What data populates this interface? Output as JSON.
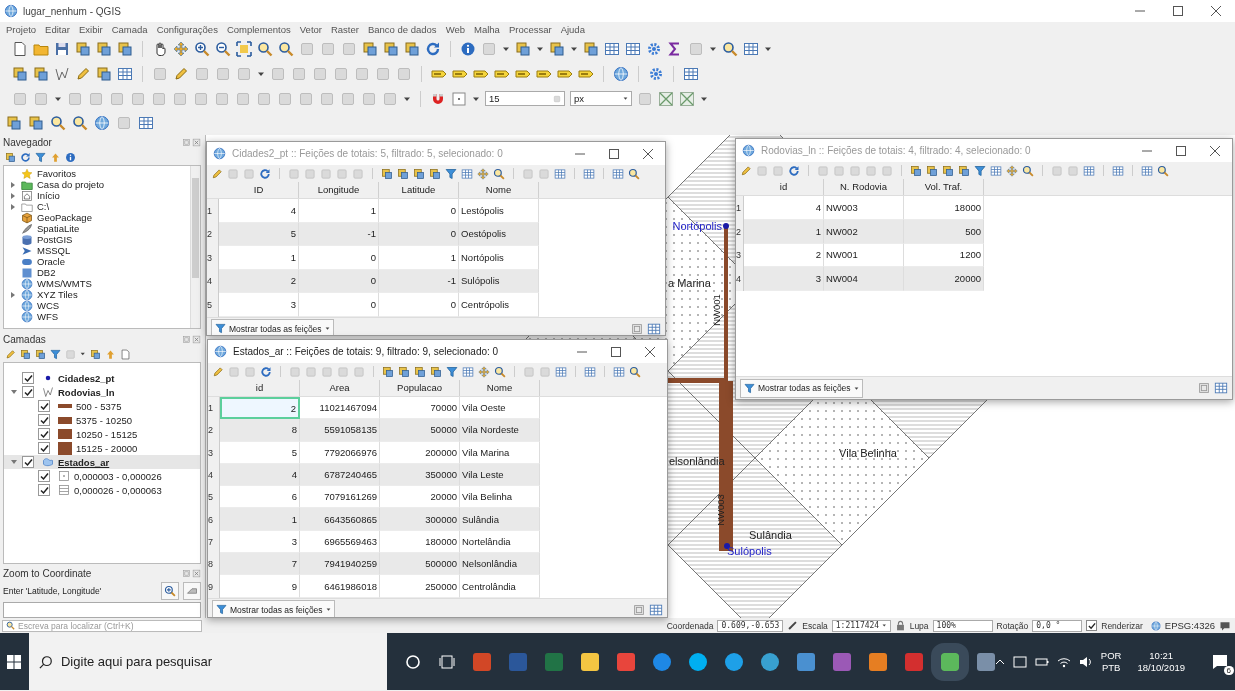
{
  "window": {
    "title": "lugar_nenhum - QGIS"
  },
  "menu": [
    "Projeto",
    "Editar",
    "Exibir",
    "Camada",
    "Configurações",
    "Complementos",
    "Vetor",
    "Raster",
    "Banco de dados",
    "Web",
    "Malha",
    "Processar",
    "Ajuda"
  ],
  "snapping": {
    "tolerance": "15",
    "unit": "px"
  },
  "navigator": {
    "title": "Navegador",
    "items": [
      {
        "label": "Favoritos",
        "kind": "favorites",
        "expandable": false
      },
      {
        "label": "Casa do projeto",
        "kind": "project",
        "expandable": true
      },
      {
        "label": "Início",
        "kind": "home",
        "expandable": true
      },
      {
        "label": "C:\\",
        "kind": "folder",
        "expandable": true
      },
      {
        "label": "GeoPackage",
        "kind": "geopackage",
        "expandable": false
      },
      {
        "label": "SpatiaLite",
        "kind": "spatialite",
        "expandable": false
      },
      {
        "label": "PostGIS",
        "kind": "database",
        "expandable": false
      },
      {
        "label": "MSSQL",
        "kind": "mssql",
        "expandable": false
      },
      {
        "label": "Oracle",
        "kind": "oracle",
        "expandable": false
      },
      {
        "label": "DB2",
        "kind": "db2",
        "expandable": false
      },
      {
        "label": "WMS/WMTS",
        "kind": "service",
        "expandable": false
      },
      {
        "label": "XYZ Tiles",
        "kind": "service",
        "expandable": true
      },
      {
        "label": "WCS",
        "kind": "service",
        "expandable": false
      },
      {
        "label": "WFS",
        "kind": "service",
        "expandable": false
      }
    ]
  },
  "layers": {
    "title": "Camadas",
    "items": [
      {
        "name": "Cidades2_pt",
        "kind": "point",
        "checked": true,
        "selected": false
      },
      {
        "name": "Rodovias_ln",
        "kind": "line",
        "checked": true,
        "selected": false,
        "expanded": true,
        "children": [
          {
            "label": "500 - 5375",
            "kind": "road-class",
            "checked": true
          },
          {
            "label": "5375 - 10250",
            "kind": "road-class",
            "checked": true
          },
          {
            "label": "10250 - 15125",
            "kind": "road-class",
            "checked": true
          },
          {
            "label": "15125 - 20000",
            "kind": "road-class",
            "checked": true
          }
        ]
      },
      {
        "name": "Estados_ar",
        "kind": "polygon",
        "checked": true,
        "selected": true,
        "expanded": true,
        "children": [
          {
            "label": "0,000003 - 0,000026",
            "kind": "dots",
            "checked": true
          },
          {
            "label": "0,000026 - 0,000063",
            "kind": "hatch",
            "checked": true
          }
        ]
      }
    ]
  },
  "zoom_to_coordinate": {
    "title": "Zoom to Coordinate",
    "label": "Enter 'Latitude, Longitude'"
  },
  "locator": {
    "placeholder": "Escreva para localizar (Ctrl+K)"
  },
  "map": {
    "labels": [
      {
        "text": "Nortópolis",
        "kind": "city"
      },
      {
        "text": "a Marina",
        "kind": "state"
      },
      {
        "text": "NW001",
        "kind": "road"
      },
      {
        "text": "elsonlândia",
        "kind": "state"
      },
      {
        "text": "Vila Belinha",
        "kind": "state"
      },
      {
        "text": "NW003",
        "kind": "road"
      },
      {
        "text": "Sulândia",
        "kind": "state"
      },
      {
        "text": "Sulópolis",
        "kind": "city"
      }
    ]
  },
  "attribute_tables": [
    {
      "title": "Cidades2_pt :: Feições de totais: 5, filtrado: 5, selecionado: 0",
      "active": false,
      "columns": [
        {
          "label": "ID",
          "kind": "number"
        },
        {
          "label": "Longitude",
          "kind": "number"
        },
        {
          "label": "Latitude",
          "kind": "number"
        },
        {
          "label": "Nome",
          "kind": "text"
        }
      ],
      "rows": [
        {
          "number": "1",
          "cells": [
            "4",
            "1",
            "0",
            "Lestópolis"
          ],
          "current": false
        },
        {
          "number": "2",
          "cells": [
            "5",
            "-1",
            "0",
            "Oestópolis"
          ],
          "current": false
        },
        {
          "number": "3",
          "cells": [
            "1",
            "0",
            "1",
            "Nortópolis"
          ],
          "current": false
        },
        {
          "number": "4",
          "cells": [
            "2",
            "0",
            "-1",
            "Sulópolis"
          ],
          "current": false
        },
        {
          "number": "5",
          "cells": [
            "3",
            "0",
            "0",
            "Centrópolis"
          ],
          "current": false
        }
      ],
      "filter_button": "Mostrar todas as feições"
    },
    {
      "title": "Estados_ar :: Feições de totais: 9, filtrado: 9, selecionado: 0",
      "active": true,
      "columns": [
        {
          "label": "id",
          "kind": "number"
        },
        {
          "label": "Area",
          "kind": "number"
        },
        {
          "label": "Populacao",
          "kind": "number"
        },
        {
          "label": "Nome",
          "kind": "text"
        }
      ],
      "rows": [
        {
          "number": "1",
          "cells": [
            "2",
            "11021467094",
            "70000",
            "Vila Oeste"
          ],
          "current": true
        },
        {
          "number": "2",
          "cells": [
            "8",
            "5591058135",
            "50000",
            "Vila Nordeste"
          ],
          "current": false
        },
        {
          "number": "3",
          "cells": [
            "5",
            "7792066976",
            "200000",
            "Vila Marina"
          ],
          "current": false
        },
        {
          "number": "4",
          "cells": [
            "4",
            "6787240465",
            "350000",
            "Vila Leste"
          ],
          "current": false
        },
        {
          "number": "5",
          "cells": [
            "6",
            "7079161269",
            "20000",
            "Vila Belinha"
          ],
          "current": false
        },
        {
          "number": "6",
          "cells": [
            "1",
            "6643560865",
            "300000",
            "Sulândia"
          ],
          "current": false
        },
        {
          "number": "7",
          "cells": [
            "3",
            "6965569463",
            "180000",
            "Nortelândia"
          ],
          "current": false
        },
        {
          "number": "8",
          "cells": [
            "7",
            "7941940259",
            "500000",
            "Nelsonlândia"
          ],
          "current": false
        },
        {
          "number": "9",
          "cells": [
            "9",
            "6461986018",
            "250000",
            "Centrolândia"
          ],
          "current": false
        }
      ],
      "filter_button": "Mostrar todas as feições"
    },
    {
      "title": "Rodovias_ln :: Feições de totais: 4, filtrado: 4, selecionado: 0",
      "active": false,
      "columns": [
        {
          "label": "id",
          "kind": "number"
        },
        {
          "label": "N. Rodovia",
          "kind": "text"
        },
        {
          "label": "Vol. Traf.",
          "kind": "number"
        }
      ],
      "rows": [
        {
          "number": "1",
          "cells": [
            "4",
            "NW003",
            "18000"
          ],
          "current": false
        },
        {
          "number": "2",
          "cells": [
            "1",
            "NW002",
            "500"
          ],
          "current": false
        },
        {
          "number": "3",
          "cells": [
            "2",
            "NW001",
            "1200"
          ],
          "current": false
        },
        {
          "number": "4",
          "cells": [
            "3",
            "NW004",
            "20000"
          ],
          "current": false
        }
      ],
      "filter_button": "Mostrar todas as feições"
    }
  ],
  "status_bar": {
    "coordinate_label": "Coordenada",
    "coordinate": "0.609,-0.653",
    "scale_label": "Escala",
    "scale": "1:2117424",
    "magnifier_label": "Lupa",
    "magnifier": "100%",
    "rotation_label": "Rotação",
    "rotation": "0,0 °",
    "render_label": "Renderizar",
    "render": true,
    "crs": "EPSG:4326"
  },
  "taskbar": {
    "search_placeholder": "Digite aqui para pesquisar",
    "language": "POR",
    "keyboard": "PTB",
    "time": "10:21",
    "date": "18/10/2019",
    "notifications": "6"
  }
}
